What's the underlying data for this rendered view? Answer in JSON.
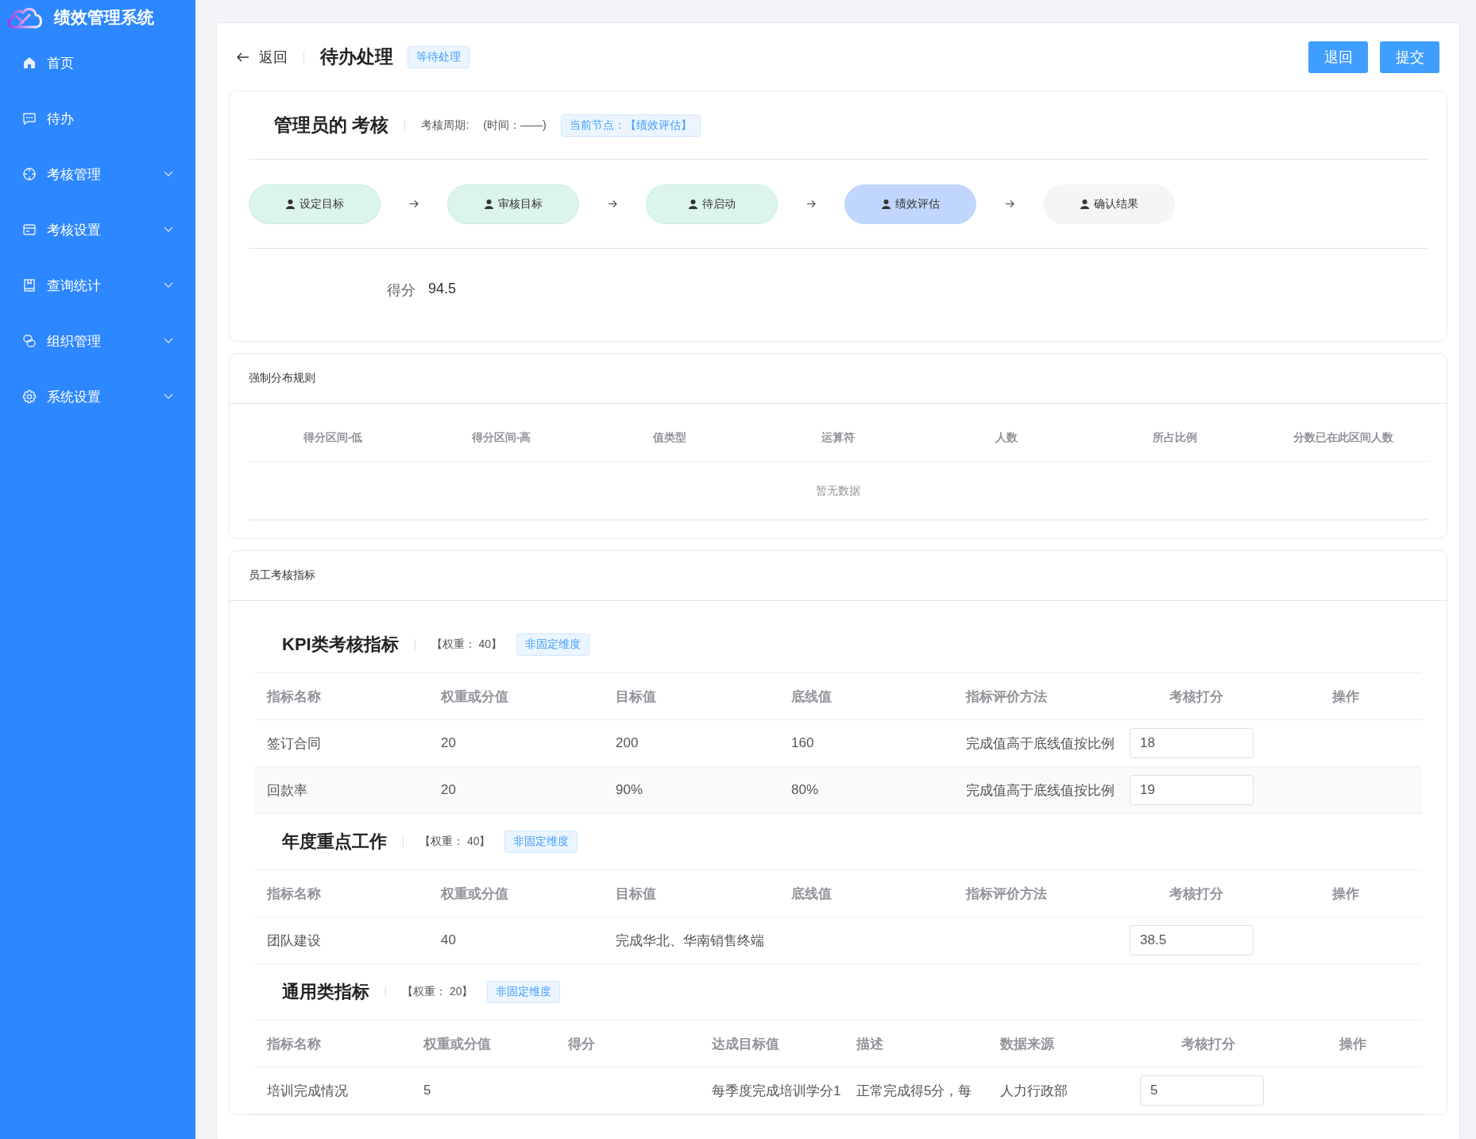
{
  "app": {
    "title": "绩效管理系统"
  },
  "sidebar": {
    "items": [
      {
        "label": "首页",
        "expandable": false
      },
      {
        "label": "待办",
        "expandable": false
      },
      {
        "label": "考核管理",
        "expandable": true
      },
      {
        "label": "考核设置",
        "expandable": true
      },
      {
        "label": "查询统计",
        "expandable": true
      },
      {
        "label": "组织管理",
        "expandable": true
      },
      {
        "label": "系统设置",
        "expandable": true
      }
    ]
  },
  "header": {
    "back": "返回",
    "title": "待办处理",
    "status_tag": "等待处理",
    "buttons": [
      "退回",
      "提交"
    ]
  },
  "review": {
    "title": "管理员的 考核",
    "period_label": "考核周期:",
    "period_value": "(时间：——)",
    "node_tag": "当前节点：【绩效评估】",
    "steps": [
      {
        "label": "设定目标",
        "completed": true,
        "selected": false
      },
      {
        "label": "审核目标",
        "completed": true,
        "selected": false
      },
      {
        "label": "待启动",
        "completed": true,
        "selected": false
      },
      {
        "label": "绩效评估",
        "completed": false,
        "selected": true
      },
      {
        "label": "确认结果",
        "completed": false,
        "selected": false
      }
    ],
    "score_label": "得分",
    "score_value": "94.5"
  },
  "distribution": {
    "title": "强制分布规则",
    "columns": [
      "得分区间-低",
      "得分区间-高",
      "值类型",
      "运算符",
      "人数",
      "所占比例",
      "分数已在此区间人数"
    ],
    "empty_text": "暂无数据"
  },
  "indicators": {
    "title": "员工考核指标",
    "sections": [
      {
        "title": "KPI类考核指标",
        "weight": "【权重：  40】",
        "tag": "非固定维度",
        "columns": [
          "指标名称",
          "权重或分值",
          "目标值",
          "底线值",
          "指标评价方法",
          "考核打分",
          "操作"
        ],
        "rows": [
          {
            "cells": [
              "签订合同",
              "20",
              "200",
              "160",
              "完成值高于底线值按比例"
            ],
            "score": "18"
          },
          {
            "cells": [
              "回款率",
              "20",
              "90%",
              "80%",
              "完成值高于底线值按比例"
            ],
            "score": "19"
          }
        ]
      },
      {
        "title": "年度重点工作",
        "weight": "【权重：  40】",
        "tag": "非固定维度",
        "columns": [
          "指标名称",
          "权重或分值",
          "目标值",
          "底线值",
          "指标评价方法",
          "考核打分",
          "操作"
        ],
        "rows": [
          {
            "cells": [
              "团队建设",
              "40",
              "完成华北、华南销售终端",
              "",
              ""
            ],
            "score": "38.5"
          }
        ]
      },
      {
        "title": "通用类指标",
        "weight": "【权重：  20】",
        "tag": "非固定维度",
        "columns": [
          "指标名称",
          "权重或分值",
          "得分",
          "达成目标值",
          "描述",
          "数据来源",
          "考核打分",
          "操作"
        ],
        "rows": [
          {
            "cells": [
              "培训完成情况",
              "5",
              "",
              "每季度完成培训学分1",
              "正常完成得5分，每",
              "人力行政部"
            ],
            "score": "5"
          }
        ]
      }
    ]
  }
}
